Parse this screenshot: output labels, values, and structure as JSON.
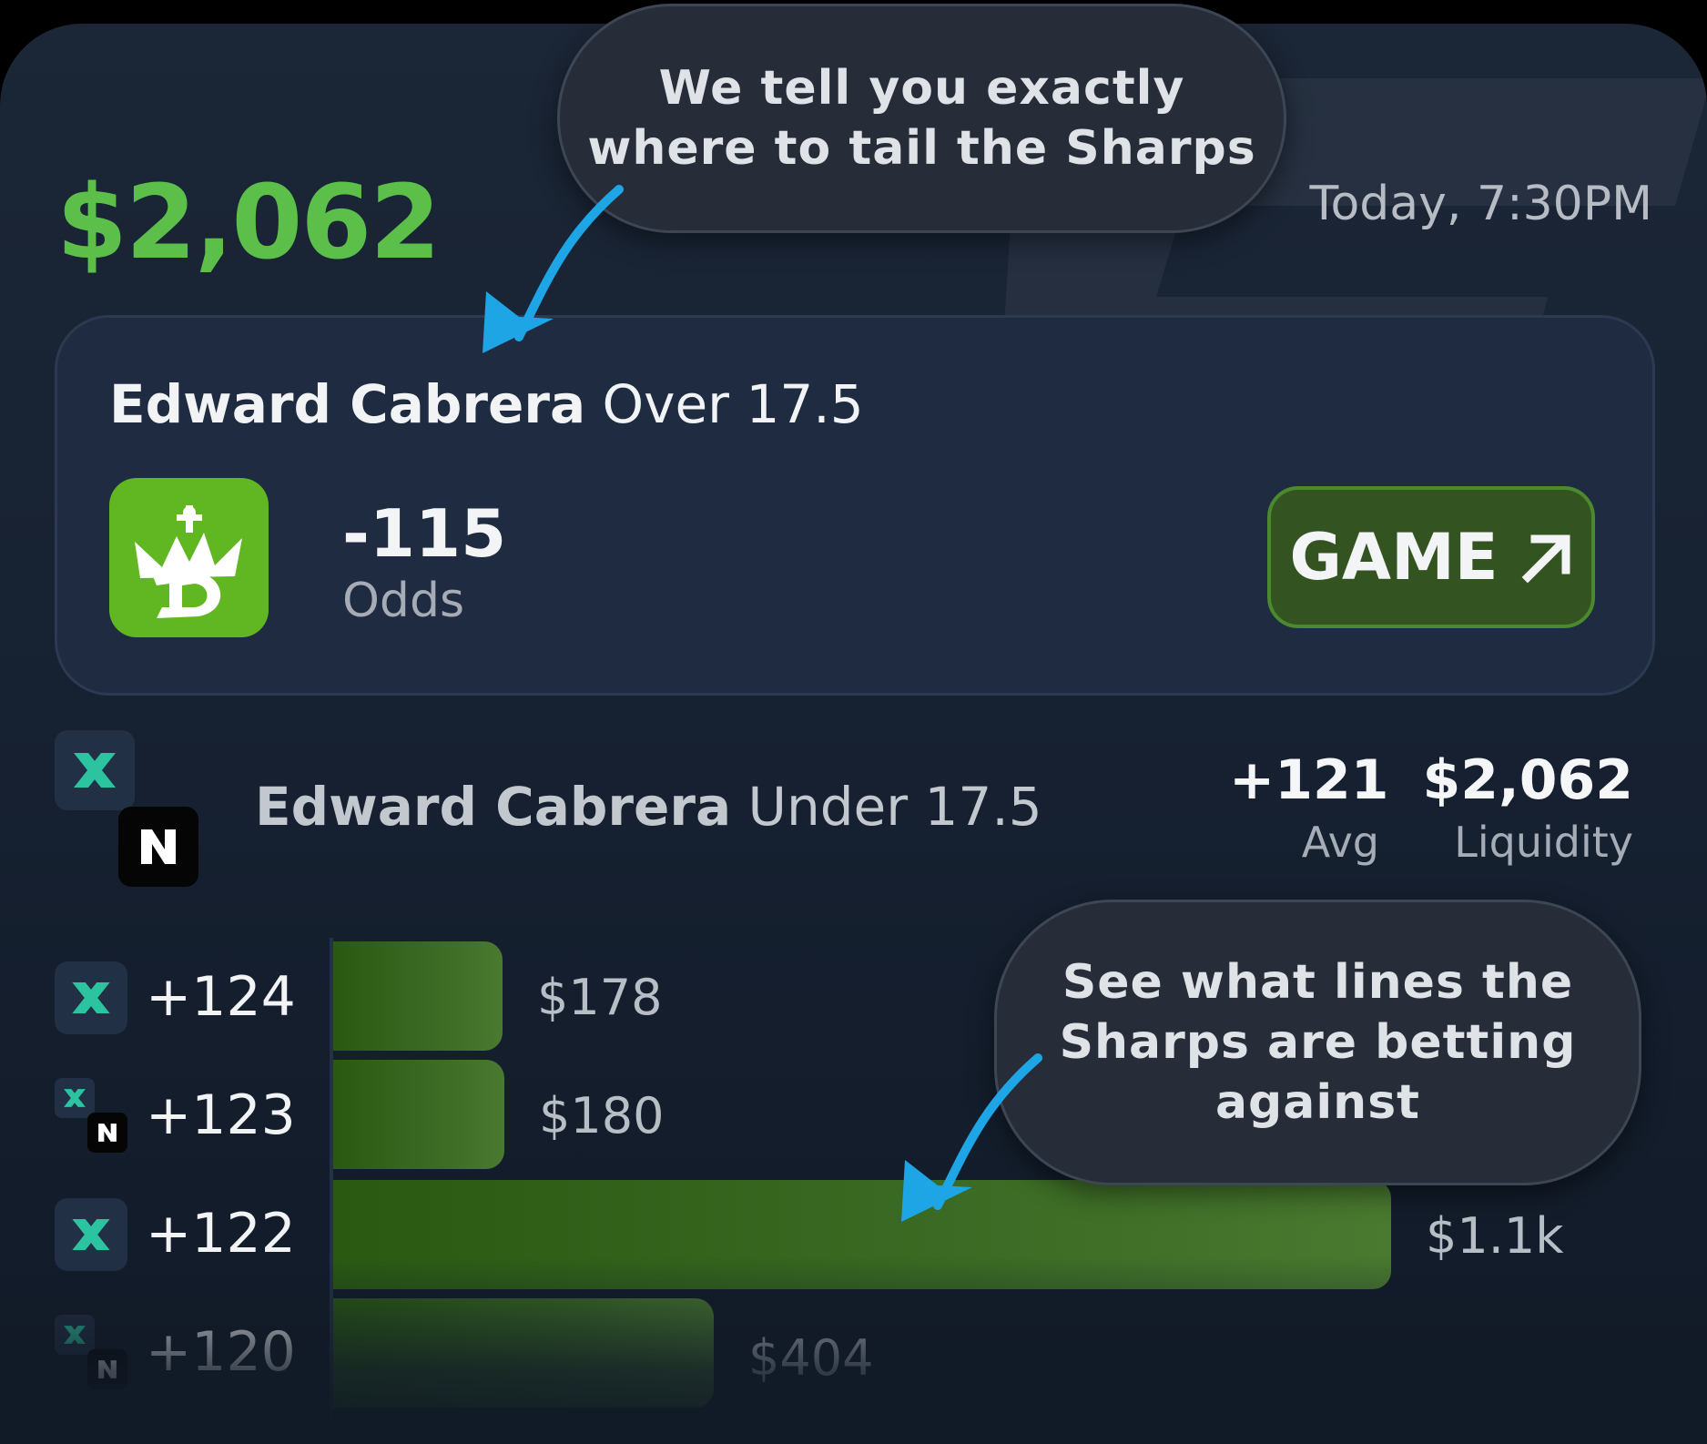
{
  "header": {
    "amount": "$2,062",
    "time": "Today, 7:30PM"
  },
  "callouts": {
    "top": "We tell you exactly\nwhere to tail the Sharps",
    "bottom": "See what lines the\nSharps are betting\nagainst"
  },
  "card": {
    "player": "Edward Cabrera",
    "line": "Over 17.5",
    "odds_value": "-115",
    "odds_label": "Odds",
    "button_label": "GAME",
    "book_icon": "draftkings-logo-icon",
    "accent": "#61b721"
  },
  "section": {
    "player": "Edward Cabrera",
    "line": "Under 17.5",
    "avg_value": "+121",
    "avg_label": "Avg",
    "liquidity_value": "$2,062",
    "liquidity_label": "Liquidity"
  },
  "rows": [
    {
      "odds": "+124",
      "amount": "$178",
      "fraction": 0.16
    },
    {
      "odds": "+123",
      "amount": "$180",
      "fraction": 0.162
    },
    {
      "odds": "+122",
      "amount": "$1.1k",
      "fraction": 1.0
    },
    {
      "odds": "+120",
      "amount": "$404",
      "fraction": 0.36
    }
  ],
  "colors": {
    "amount_green": "#5cbf4a",
    "button_bg": "#335420",
    "callout_arrow": "#1ea5e6"
  }
}
